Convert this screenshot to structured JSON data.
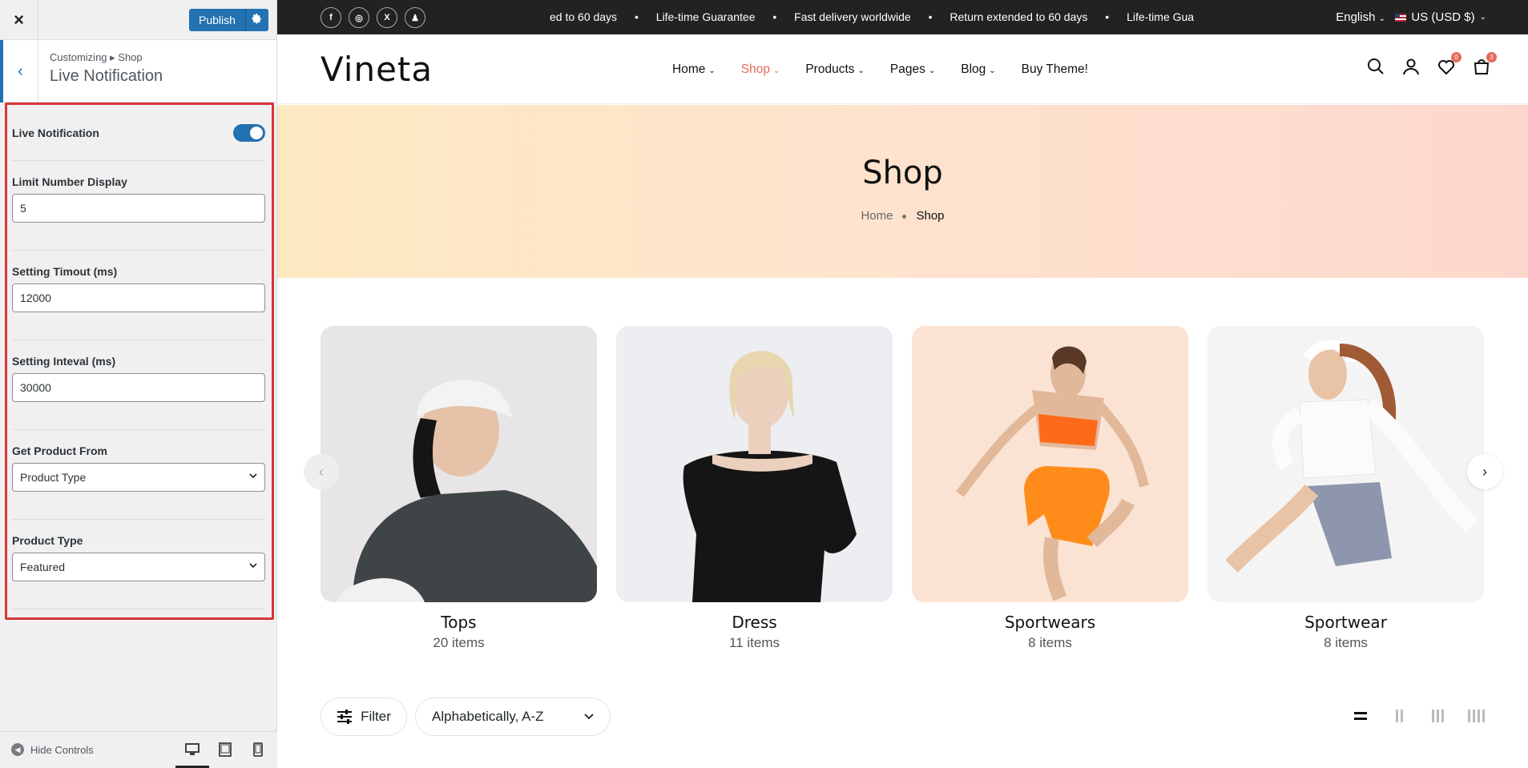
{
  "customizer": {
    "close_label": "×",
    "publish_label": "Publish",
    "breadcrumb": "Customizing ▸ Shop",
    "section_title": "Live Notification",
    "controls": {
      "live_notification": {
        "label": "Live Notification",
        "enabled": true
      },
      "limit_number": {
        "label": "Limit Number Display",
        "value": "5"
      },
      "timeout": {
        "label": "Setting Timout (ms)",
        "value": "12000"
      },
      "interval": {
        "label": "Setting Inteval (ms)",
        "value": "30000"
      },
      "product_from": {
        "label": "Get Product From",
        "value": "Product Type"
      },
      "product_type": {
        "label": "Product Type",
        "value": "Featured"
      }
    },
    "hide_controls_label": "Hide Controls",
    "accent_color": "#2271b1",
    "highlight_color": "#d63638"
  },
  "site": {
    "topbar": {
      "social": [
        "f",
        "◎",
        "X",
        "♟"
      ],
      "marquee": [
        "ed to 60 days",
        "•",
        "Life-time Guarantee",
        "•",
        "Fast delivery worldwide",
        "•",
        "Return extended to 60 days",
        "•",
        "Life-time Gua"
      ],
      "language": "English",
      "currency": "US (USD $)"
    },
    "logo": "Vineta",
    "menu": [
      {
        "label": "Home",
        "has_dropdown": true,
        "active": false
      },
      {
        "label": "Shop",
        "has_dropdown": true,
        "active": true
      },
      {
        "label": "Products",
        "has_dropdown": true,
        "active": false
      },
      {
        "label": "Pages",
        "has_dropdown": true,
        "active": false
      },
      {
        "label": "Blog",
        "has_dropdown": true,
        "active": false
      },
      {
        "label": "Buy Theme!",
        "has_dropdown": false,
        "active": false
      }
    ],
    "wishlist_count": "0",
    "cart_count": "3",
    "hero": {
      "title": "Shop",
      "crumb_home": "Home",
      "crumb_current": "Shop"
    },
    "categories": [
      {
        "name": "Tops",
        "count": "20 items"
      },
      {
        "name": "Dress",
        "count": "11 items"
      },
      {
        "name": "Sportwears",
        "count": "8 items"
      },
      {
        "name": "Sportwear",
        "count": "8 items"
      }
    ],
    "filter_label": "Filter",
    "sort_value": "Alphabetically, A-Z",
    "active_color": "#e56b5a"
  }
}
